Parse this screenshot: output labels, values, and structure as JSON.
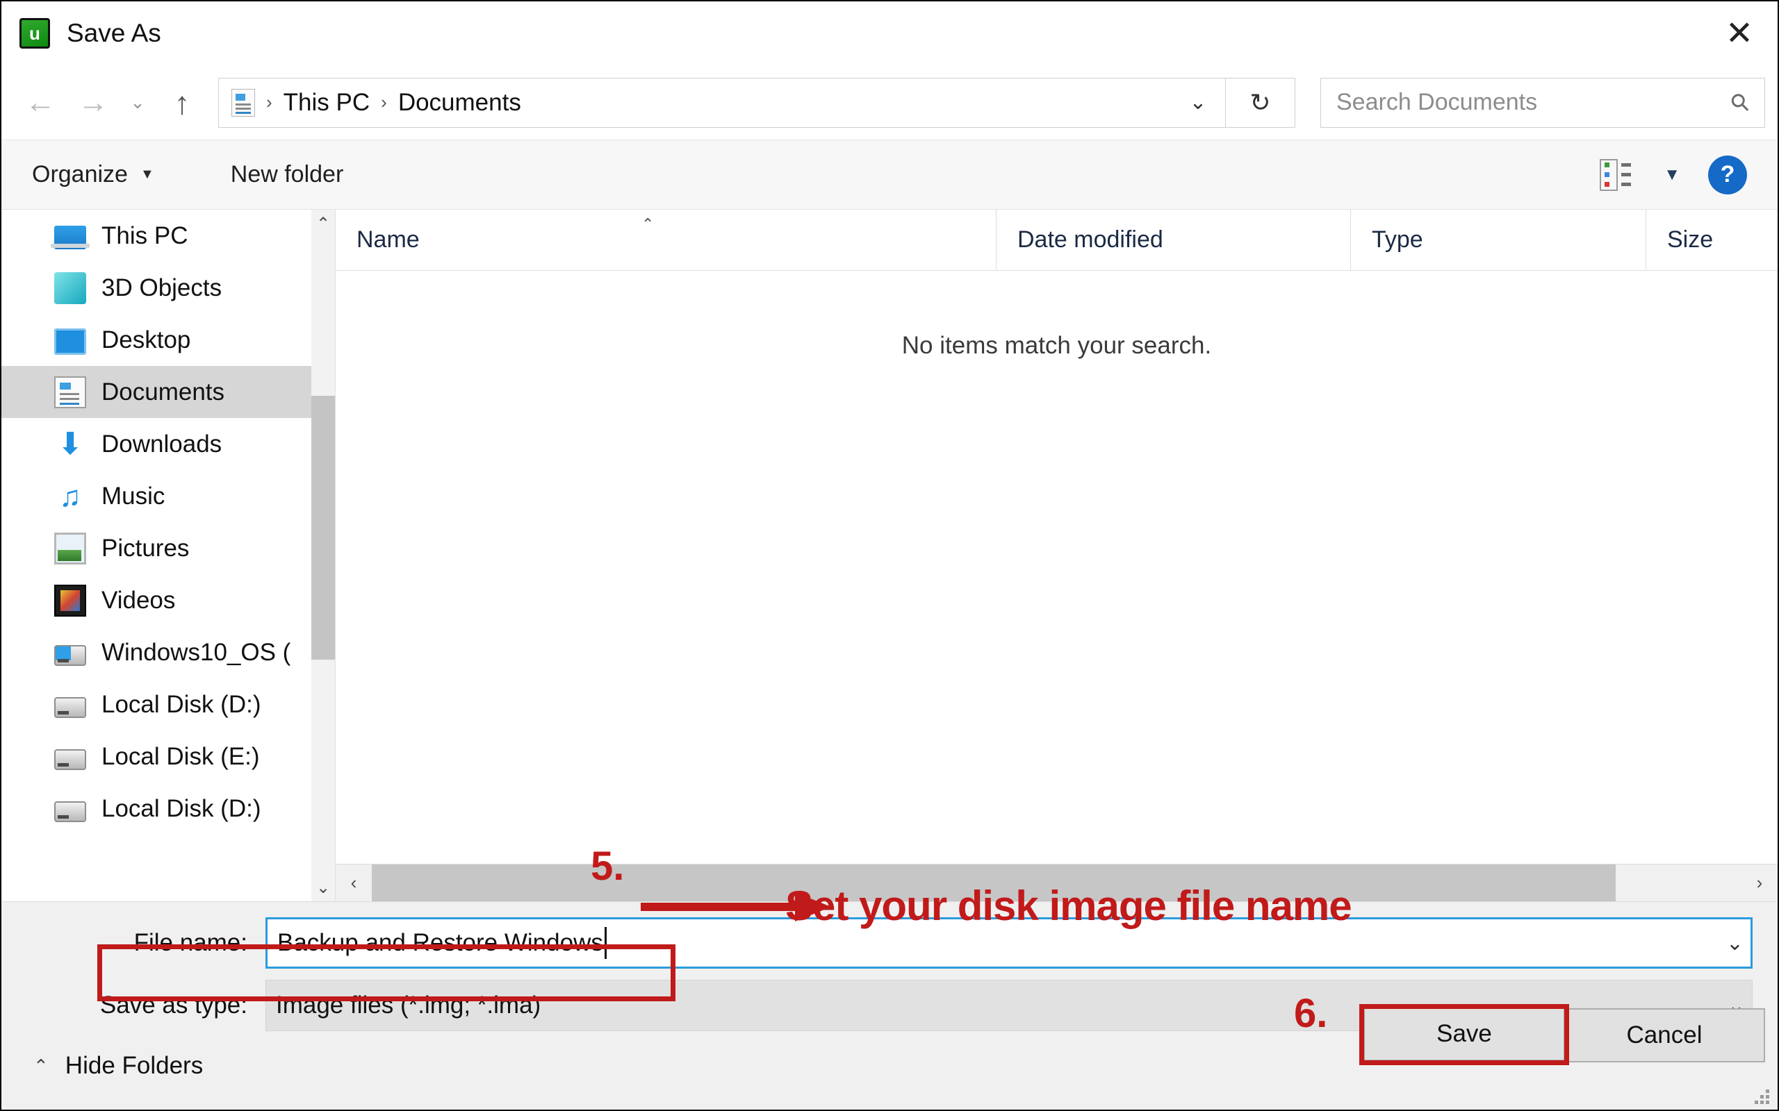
{
  "window": {
    "title": "Save As",
    "app_icon": "u",
    "close_icon": "✕"
  },
  "nav": {
    "back_icon": "←",
    "forward_icon": "→",
    "history_icon": "⌄",
    "up_icon": "↑",
    "breadcrumb": [
      "This PC",
      "Documents"
    ],
    "breadcrumb_sep": "›",
    "breadcrumb_dropdown_icon": "⌄",
    "refresh_icon": "↻"
  },
  "search": {
    "placeholder": "Search Documents",
    "icon": "search-icon"
  },
  "toolbar": {
    "organize_label": "Organize",
    "organize_caret": "▼",
    "new_folder_label": "New folder",
    "view_caret": "▼",
    "help_label": "?"
  },
  "sidebar": {
    "items": [
      {
        "label": "This PC",
        "icon": "pc-icon",
        "selected": false
      },
      {
        "label": "3D Objects",
        "icon": "cube-icon",
        "selected": false
      },
      {
        "label": "Desktop",
        "icon": "monitor-icon",
        "selected": false
      },
      {
        "label": "Documents",
        "icon": "document-icon",
        "selected": true
      },
      {
        "label": "Downloads",
        "icon": "download-arrow-icon",
        "selected": false
      },
      {
        "label": "Music",
        "icon": "music-note-icon",
        "selected": false
      },
      {
        "label": "Pictures",
        "icon": "picture-icon",
        "selected": false
      },
      {
        "label": "Videos",
        "icon": "film-icon",
        "selected": false
      },
      {
        "label": "Windows10_OS (",
        "icon": "windows-drive-icon",
        "selected": false
      },
      {
        "label": "Local Disk (D:)",
        "icon": "drive-icon",
        "selected": false
      },
      {
        "label": "Local Disk (E:)",
        "icon": "drive-icon",
        "selected": false
      },
      {
        "label": "Local Disk (D:)",
        "icon": "drive-icon",
        "selected": false
      }
    ],
    "scroll_up_icon": "⌃",
    "scroll_down_icon": "⌄"
  },
  "filelist": {
    "columns": [
      "Name",
      "Date modified",
      "Type",
      "Size"
    ],
    "sort_caret": "⌃",
    "empty_message": "No items match your search.",
    "rows": []
  },
  "hscroll": {
    "left_icon": "‹",
    "right_icon": "›"
  },
  "footer": {
    "file_name_label": "File name:",
    "file_name_value": "Backup and Restore Windows",
    "file_name_dropdown_icon": "⌄",
    "save_as_type_label": "Save as type:",
    "save_as_type_value": "Image files (*.img; *.ima)",
    "save_as_type_dropdown_icon": "⌄",
    "hide_folders_label": "Hide Folders",
    "hide_folders_caret": "⌃",
    "save_label": "Save",
    "cancel_label": "Cancel"
  },
  "annotations": {
    "step5_number": "5.",
    "step5_text": "Set your disk image file name",
    "step6_number": "6.",
    "accent_color": "#c11a1a"
  }
}
